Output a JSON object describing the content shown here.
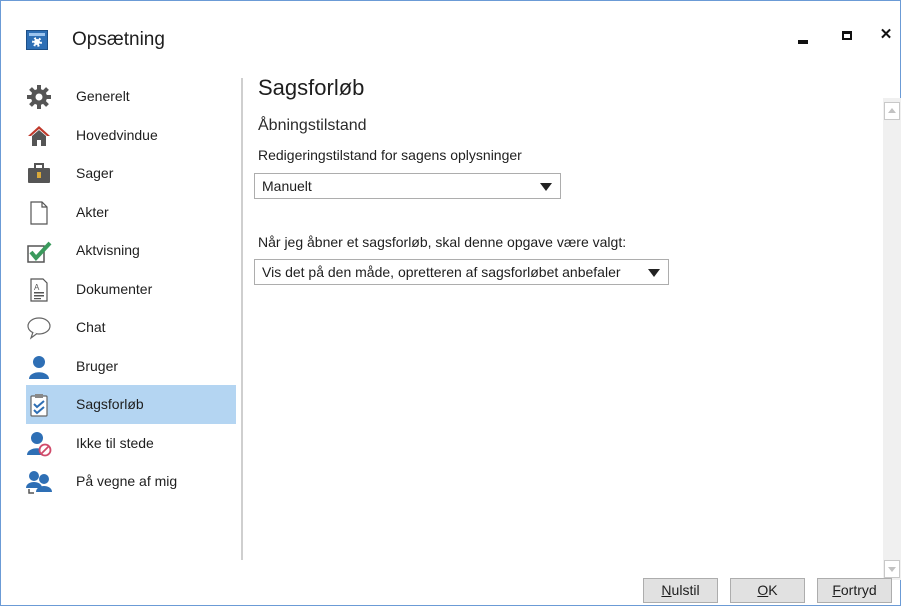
{
  "window": {
    "title": "Opsætning"
  },
  "sidebar": {
    "items": [
      {
        "label": "Generelt",
        "icon": "gear-icon"
      },
      {
        "label": "Hovedvindue",
        "icon": "home-icon"
      },
      {
        "label": "Sager",
        "icon": "briefcase-icon"
      },
      {
        "label": "Akter",
        "icon": "document-icon"
      },
      {
        "label": "Aktvisning",
        "icon": "checkmark-icon"
      },
      {
        "label": "Dokumenter",
        "icon": "text-document-icon"
      },
      {
        "label": "Chat",
        "icon": "chat-bubble-icon"
      },
      {
        "label": "Bruger",
        "icon": "user-icon"
      },
      {
        "label": "Sagsforløb",
        "icon": "clipboard-check-icon",
        "selected": true
      },
      {
        "label": "Ikke til stede",
        "icon": "user-absent-icon"
      },
      {
        "label": "På vegne af mig",
        "icon": "users-delegate-icon"
      }
    ]
  },
  "main": {
    "heading": "Sagsforløb",
    "section": "Åbningstilstand",
    "field1": {
      "label": "Redigeringstilstand for sagens oplysninger",
      "value": "Manuelt"
    },
    "field2": {
      "label": "Når jeg åbner et sagsforløb, skal denne opgave være valgt:",
      "value": "Vis det på den måde, opretteren af sagsforløbet anbefaler"
    }
  },
  "buttons": {
    "reset": {
      "mnemonic": "N",
      "rest": "ulstil"
    },
    "ok": {
      "mnemonic": "O",
      "rest": "K"
    },
    "cancel": {
      "mnemonic": "F",
      "rest": "ortryd"
    }
  },
  "colors": {
    "accent": "#2e6fb5",
    "selected_bg": "#b4d5f2",
    "window_border": "#6b9bd6"
  }
}
